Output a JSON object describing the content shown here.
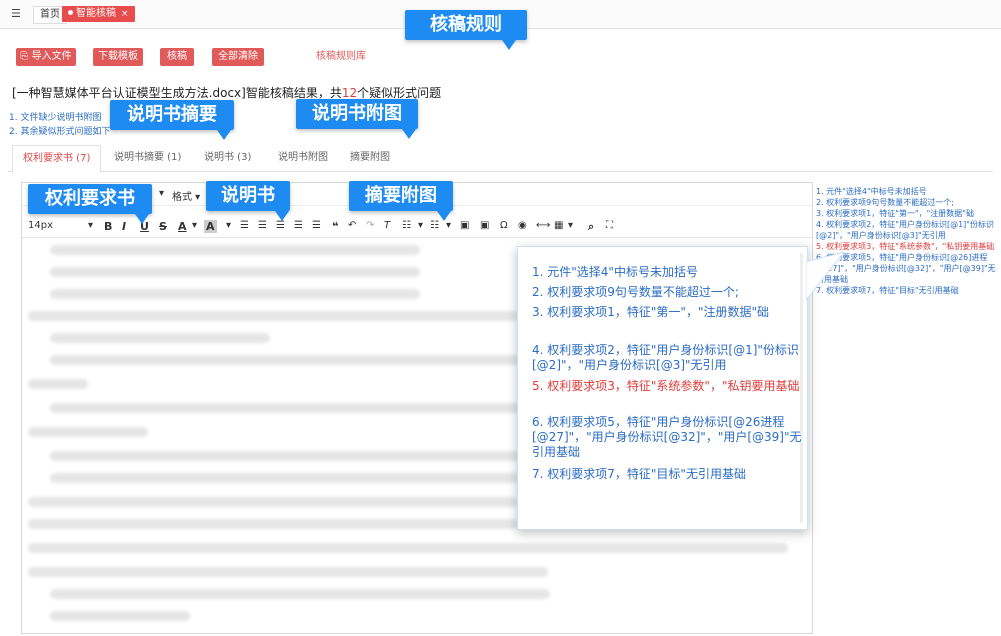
{
  "topbar": {
    "menu_icon": "menu-icon",
    "home_tab": "首页",
    "active_tab": "智能核稿",
    "close": "×"
  },
  "actions": {
    "import": "导入文件",
    "download": "下载模板",
    "check": "核稿",
    "clear": "全部清除",
    "rules_link": "核稿规则库"
  },
  "callouts": {
    "rules": "核稿规则",
    "abstract": "说明书摘要",
    "figures": "说明书附图",
    "claims": "权利要求书",
    "spec": "说明书",
    "abstract_figure": "摘要附图"
  },
  "result": {
    "prefix": "[一种智慧媒体平台认证模型生成方法.docx]智能核稿结果，共",
    "count": "12",
    "suffix": "个疑似形式问题"
  },
  "summary_issues": [
    "1. 文件缺少说明书附图",
    "2. 其余疑似形式问题如下"
  ],
  "doc_tabs": [
    "权利要求书 (7)",
    "说明书摘要 (1)",
    "说明书 (3)",
    "说明书附图",
    "摘要附图"
  ],
  "editor": {
    "format_label": "格式",
    "font_size": "14px"
  },
  "issues_right": [
    "1. 元件\"选择4\"中标号未加括号",
    "2. 权利要求项9句号数量不能超过一个;",
    "3. 权利要求项1，特征\"第一\"，\"注册数据\"础",
    "4. 权利要求项2，特征\"用户身份标识[@1]\"份标识[@2]\"，\"用户身份标识[@3]\"无引用",
    "5. 权利要求项3，特征\"系统参数\"，\"私钥要用基础",
    "6. 权利要求项5，特征\"用户身份标识[@26]进程[@27]\"，\"用户身份标识[@32]\"，\"用户[@39]\"无引用基础",
    "7. 权利要求项7，特征\"目标\"无引用基础"
  ],
  "popup_issues": [
    "1. 元件\"选择4\"中标号未加括号",
    "2. 权利要求项9句号数量不能超过一个;",
    "3. 权利要求项1，特征\"第一\"，\"注册数据\"础",
    "4. 权利要求项2，特征\"用户身份标识[@1]\"份标识[@2]\"，\"用户身份标识[@3]\"无引用",
    "5. 权利要求项3，特征\"系统参数\"，\"私钥要用基础",
    "6. 权利要求项5，特征\"用户身份标识[@26进程[@27]\"，\"用户身份标识[@32]\"，\"用户[@39]\"无引用基础",
    "7. 权利要求项7，特征\"目标\"无引用基础"
  ],
  "issue_colors": [
    "blue",
    "blue",
    "blue",
    "blue",
    "red",
    "blue",
    "blue"
  ],
  "colors": {
    "accent_red": "#e05a5a",
    "callout_blue": "#1d8bf1",
    "issue_blue": "#2b6cc4",
    "issue_red": "#e03b3b"
  }
}
